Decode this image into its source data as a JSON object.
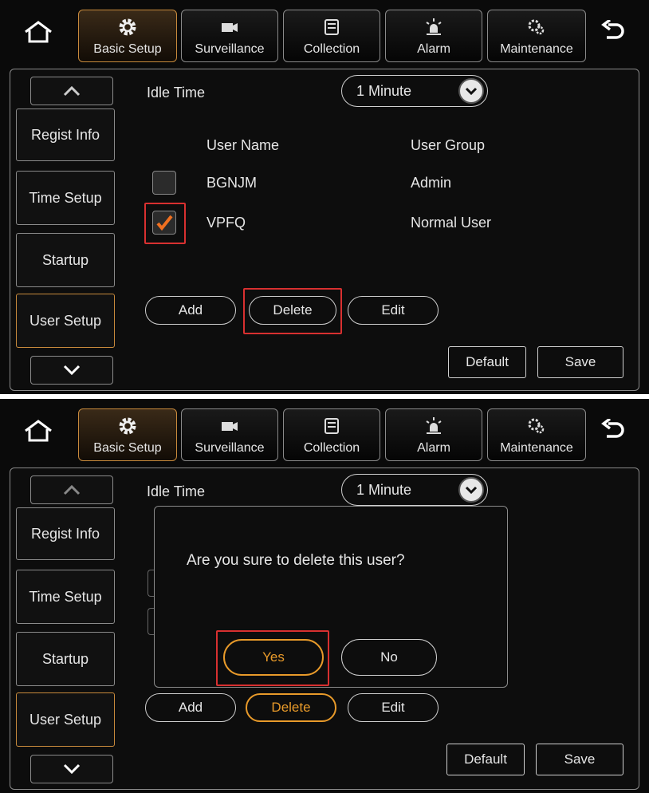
{
  "nav": {
    "tabs": [
      {
        "label": "Basic Setup",
        "icon": "gear-icon",
        "active": true
      },
      {
        "label": "Surveillance",
        "icon": "camera-icon"
      },
      {
        "label": "Collection",
        "icon": "folder-icon"
      },
      {
        "label": "Alarm",
        "icon": "alarm-light-icon"
      },
      {
        "label": "Maintenance",
        "icon": "gears-icon"
      }
    ],
    "home_icon": "home-icon",
    "back_icon": "back-arrow-icon"
  },
  "sidebar": {
    "up_icon": "chevron-up-icon",
    "down_icon": "chevron-down-icon",
    "items": [
      {
        "label": "Regist Info"
      },
      {
        "label": "Time Setup"
      },
      {
        "label": "Startup"
      },
      {
        "label": "User Setup",
        "active": true
      }
    ]
  },
  "idle_time": {
    "label": "Idle Time",
    "value": "1 Minute"
  },
  "table": {
    "headers": [
      "User Name",
      "User Group"
    ],
    "rows": [
      {
        "name": "BGNJM",
        "group": "Admin",
        "checked": false
      },
      {
        "name": "VPFQ",
        "group": "Normal User",
        "checked": true
      }
    ]
  },
  "actions": {
    "add": "Add",
    "delete": "Delete",
    "edit": "Edit",
    "default": "Default",
    "save": "Save"
  },
  "dialog": {
    "message": "Are you sure to delete this user?",
    "yes": "Yes",
    "no": "No"
  },
  "colors": {
    "accent_orange": "#e89a2a",
    "highlight_red": "#d83030",
    "check_orange": "#f07020"
  }
}
